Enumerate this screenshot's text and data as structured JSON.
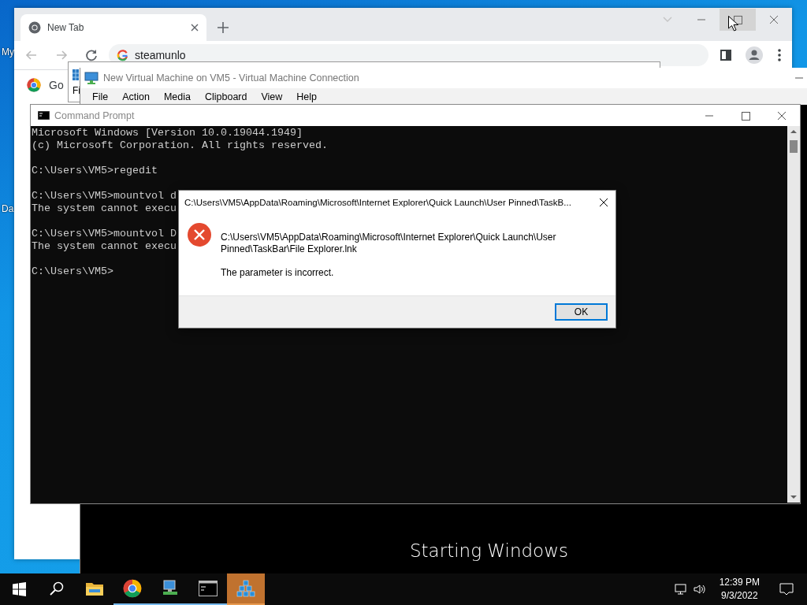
{
  "desktop": {
    "icon_labels": [
      "My",
      "Da"
    ]
  },
  "browser": {
    "tabs": [
      {
        "label": "New Tab",
        "selected": true
      }
    ],
    "address": "steamunlo",
    "shortcut": "Go"
  },
  "background_window": {
    "menu_fragment": "Fi"
  },
  "vm_window": {
    "title": "New Virtual Machine on VM5 - Virtual Machine Connection",
    "menu": [
      "File",
      "Action",
      "Media",
      "Clipboard",
      "View",
      "Help"
    ],
    "status": "Starting Windows"
  },
  "cmd_window": {
    "title": "Command Prompt",
    "blocks": [
      [
        "Microsoft Windows [Version 10.0.19044.1949]",
        "(c) Microsoft Corporation. All rights reserved."
      ],
      [
        "C:\\Users\\VM5>regedit"
      ],
      [
        "C:\\Users\\VM5>mountvol d",
        "The system cannot execu"
      ],
      [
        "C:\\Users\\VM5>mountvol D",
        "The system cannot execu"
      ],
      [
        "C:\\Users\\VM5>"
      ]
    ]
  },
  "dialog": {
    "title": "C:\\Users\\VM5\\AppData\\Roaming\\Microsoft\\Internet Explorer\\Quick Launch\\User Pinned\\TaskB...",
    "message": "C:\\Users\\VM5\\AppData\\Roaming\\Microsoft\\Internet Explorer\\Quick Launch\\User Pinned\\TaskBar\\File Explorer.lnk",
    "detail": "The parameter is incorrect.",
    "button": {
      "label": "OK",
      "focused": true
    }
  },
  "taskbar": {
    "apps": [
      {
        "kind": "folder",
        "running": false,
        "selected": false
      },
      {
        "kind": "chrome",
        "running": true,
        "selected": false
      },
      {
        "kind": "vm",
        "running": true,
        "selected": false
      },
      {
        "kind": "console",
        "running": true,
        "selected": false
      },
      {
        "kind": "registry",
        "running": true,
        "selected": true
      }
    ],
    "time": "12:39 PM",
    "date": "9/3/2022"
  }
}
